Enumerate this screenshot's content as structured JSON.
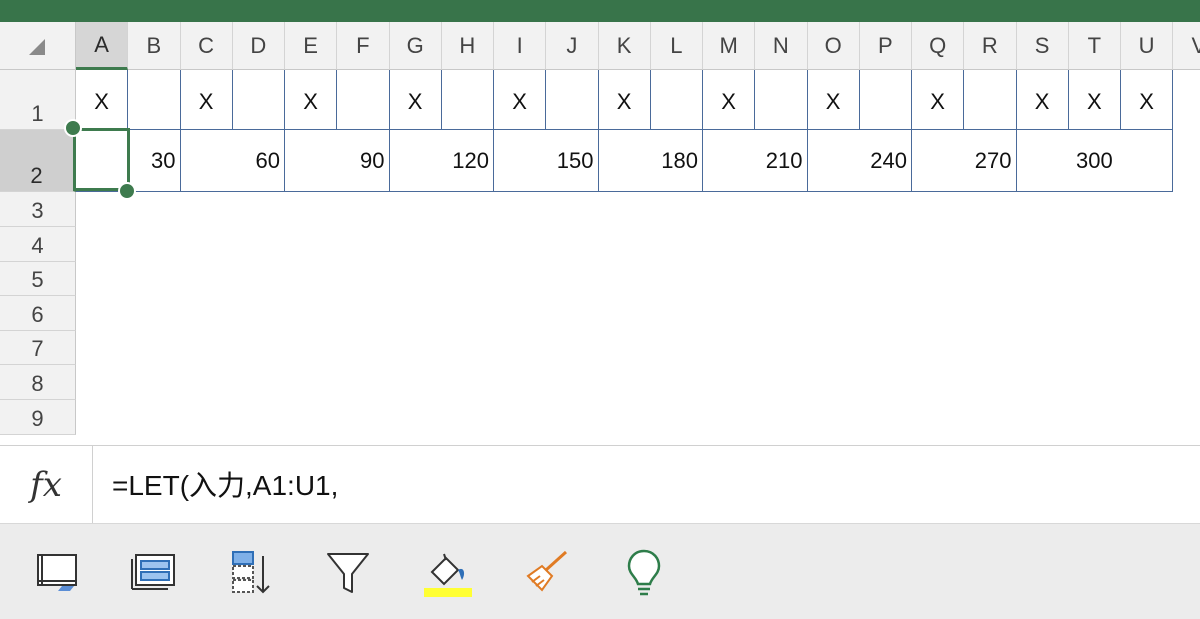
{
  "spreadsheet": {
    "columns": [
      "A",
      "B",
      "C",
      "D",
      "E",
      "F",
      "G",
      "H",
      "I",
      "J",
      "K",
      "L",
      "M",
      "N",
      "O",
      "P",
      "Q",
      "R",
      "S",
      "T",
      "U",
      "V"
    ],
    "selected_column": "A",
    "rows": [
      "1",
      "2",
      "3",
      "4",
      "5",
      "6",
      "7",
      "8",
      "9"
    ],
    "selected_row": "2",
    "row1_values": [
      "X",
      "",
      "X",
      "",
      "X",
      "",
      "X",
      "",
      "X",
      "",
      "X",
      "",
      "X",
      "",
      "X",
      "",
      "X",
      "",
      "X",
      "X",
      "X"
    ],
    "row2_cells": [
      {
        "value": ""
      },
      {
        "value": "30"
      },
      {
        "value": "60"
      },
      {
        "value": "90"
      },
      {
        "value": "120"
      },
      {
        "value": "150"
      },
      {
        "value": "180"
      },
      {
        "value": "210"
      },
      {
        "value": "240"
      },
      {
        "value": "270"
      },
      {
        "value": "300"
      }
    ]
  },
  "formula_bar": {
    "fx_label": "fx",
    "formula": "=LET(入力,A1:U1,"
  },
  "toolbar": {
    "icons": [
      "freeze-panes-icon",
      "group-rows-icon",
      "sort-icon",
      "filter-icon",
      "fill-color-icon",
      "clear-format-icon",
      "ideas-bulb-icon"
    ],
    "colors": {
      "accent": "#38744a",
      "fill_highlight": "#ffff33",
      "clear_orange": "#e07b24",
      "bulb_green": "#2e7d4a"
    }
  }
}
